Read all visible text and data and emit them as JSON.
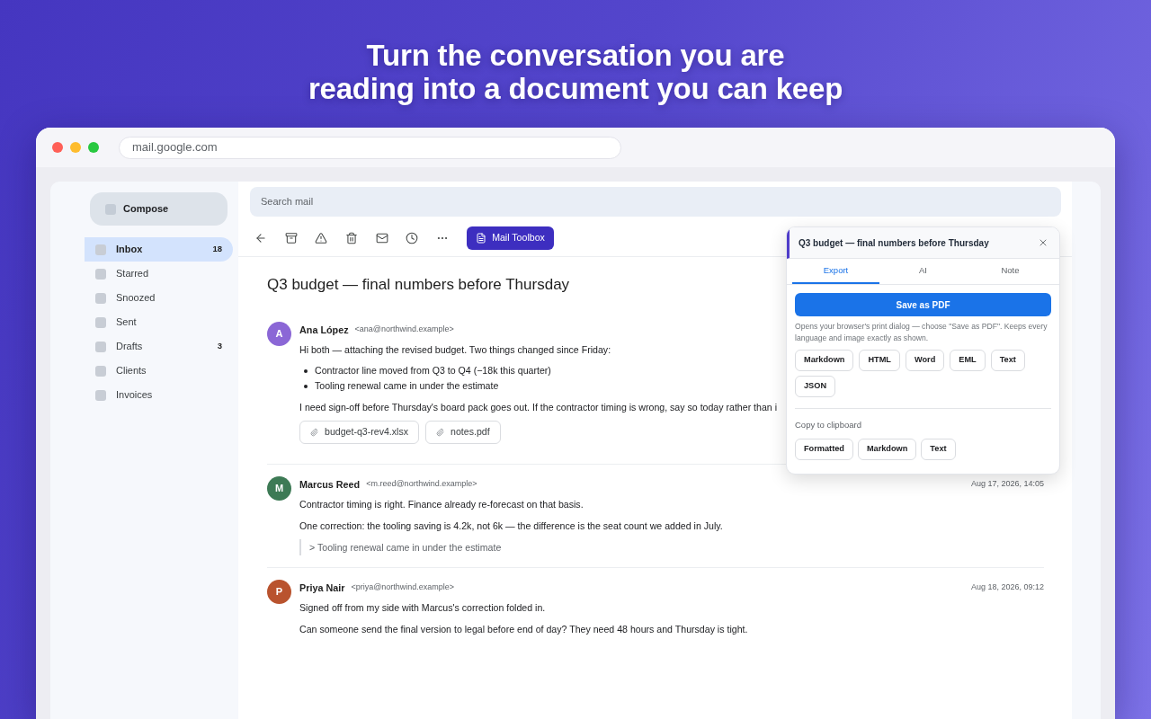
{
  "headline": [
    "Turn the conversation you are",
    "reading into a document you can keep"
  ],
  "browser": {
    "url": "mail.google.com"
  },
  "sidebar": {
    "compose": "Compose",
    "items": [
      {
        "label": "Inbox",
        "count": "18",
        "selected": true
      },
      {
        "label": "Starred",
        "selected": false
      },
      {
        "label": "Snoozed",
        "selected": false
      },
      {
        "label": "Sent",
        "selected": false
      },
      {
        "label": "Drafts",
        "count": "3",
        "selected": false
      },
      {
        "label": "Clients",
        "selected": false
      },
      {
        "label": "Invoices",
        "selected": false
      }
    ]
  },
  "search": {
    "placeholder": "Search mail"
  },
  "toolbar": {
    "extension_button": "Mail Toolbox"
  },
  "thread": {
    "subject": "Q3 budget — final numbers before Thursday",
    "messages": [
      {
        "initial": "A",
        "name": "Ana López",
        "email": "<ana@northwind.example>",
        "color": "#8b67d6",
        "blocks": [
          {
            "kind": "paragraph",
            "text": "Hi both — attaching the revised budget. Two things changed since Friday:"
          },
          {
            "kind": "bullets",
            "items": [
              "Contractor line moved from Q3 to Q4 (−18k this quarter)",
              "Tooling renewal came in under the estimate"
            ]
          },
          {
            "kind": "paragraph",
            "text": "I need sign-off before Thursday's board pack goes out. If the contractor timing is wrong, say so today rather than i"
          },
          {
            "kind": "attachments",
            "items": [
              "budget-q3-rev4.xlsx",
              "notes.pdf"
            ]
          }
        ]
      },
      {
        "initial": "M",
        "name": "Marcus Reed",
        "email": "<m.reed@northwind.example>",
        "date": "Aug 17, 2026, 14:05",
        "color": "#3d7a55",
        "blocks": [
          {
            "kind": "paragraph",
            "text": "Contractor timing is right. Finance already re-forecast on that basis."
          },
          {
            "kind": "paragraph",
            "text": "One correction: the tooling saving is 4.2k, not 6k — the difference is the seat count we added in July."
          },
          {
            "kind": "quote",
            "text": "> Tooling renewal came in under the estimate"
          }
        ]
      },
      {
        "initial": "P",
        "name": "Priya Nair",
        "email": "<priya@northwind.example>",
        "date": "Aug 18, 2026, 09:12",
        "color": "#b9532e",
        "blocks": [
          {
            "kind": "paragraph",
            "text": "Signed off from my side with Marcus's correction folded in."
          },
          {
            "kind": "paragraph",
            "text": "Can someone send the final version to legal before end of day? They need 48 hours and Thursday is tight."
          }
        ]
      }
    ]
  },
  "panel": {
    "title": "Q3 budget — final numbers before Thursday",
    "tabs": [
      {
        "label": "Export",
        "selected": true
      },
      {
        "label": "AI",
        "selected": false
      },
      {
        "label": "Note",
        "selected": false
      }
    ],
    "primary_button": "Save as PDF",
    "hint": "Opens your browser's print dialog — choose \"Save as PDF\". Keeps every language and image exactly as shown.",
    "formats": [
      "Markdown",
      "HTML",
      "Word",
      "EML",
      "Text",
      "JSON"
    ],
    "clipboard_heading": "Copy to clipboard",
    "clipboard_formats": [
      "Formatted",
      "Markdown",
      "Text"
    ]
  }
}
